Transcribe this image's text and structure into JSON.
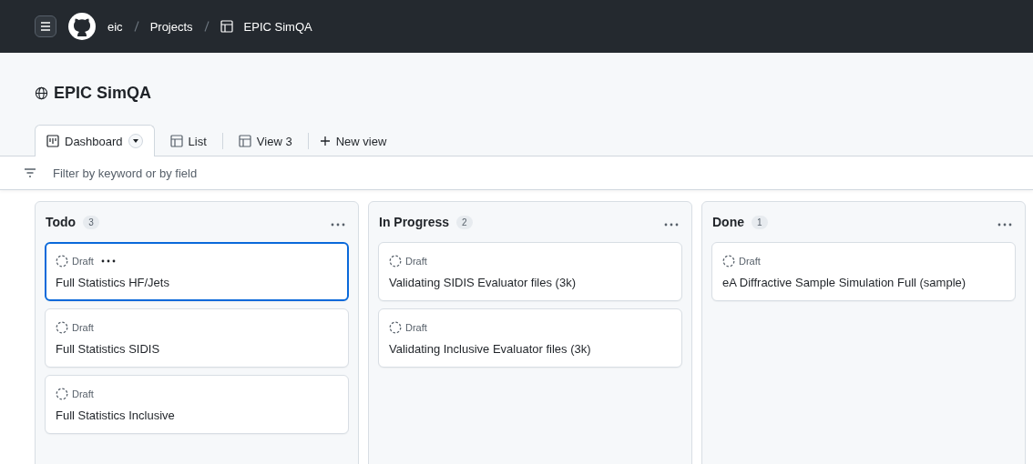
{
  "header": {
    "breadcrumbs": [
      "eic",
      "Projects",
      "EPIC SimQA"
    ]
  },
  "project": {
    "title": "EPIC SimQA"
  },
  "tabs": [
    {
      "label": "Dashboard",
      "kind": "board",
      "selected": true
    },
    {
      "label": "List",
      "kind": "table",
      "selected": false
    },
    {
      "label": "View 3",
      "kind": "table",
      "selected": false
    }
  ],
  "new_view": "New view",
  "filter": {
    "placeholder": "Filter by keyword or by field"
  },
  "columns": [
    {
      "title": "Todo",
      "count": "3",
      "cards": [
        {
          "status": "Draft",
          "title": "Full Statistics HF/Jets",
          "selected": true
        },
        {
          "status": "Draft",
          "title": "Full Statistics SIDIS",
          "selected": false
        },
        {
          "status": "Draft",
          "title": "Full Statistics Inclusive",
          "selected": false
        }
      ]
    },
    {
      "title": "In Progress",
      "count": "2",
      "cards": [
        {
          "status": "Draft",
          "title": "Validating SIDIS Evaluator files (3k)",
          "selected": false
        },
        {
          "status": "Draft",
          "title": "Validating Inclusive Evaluator files (3k)",
          "selected": false
        }
      ]
    },
    {
      "title": "Done",
      "count": "1",
      "cards": [
        {
          "status": "Draft",
          "title": "eA Diffractive Sample Simulation Full (sample)",
          "selected": false
        }
      ]
    }
  ]
}
